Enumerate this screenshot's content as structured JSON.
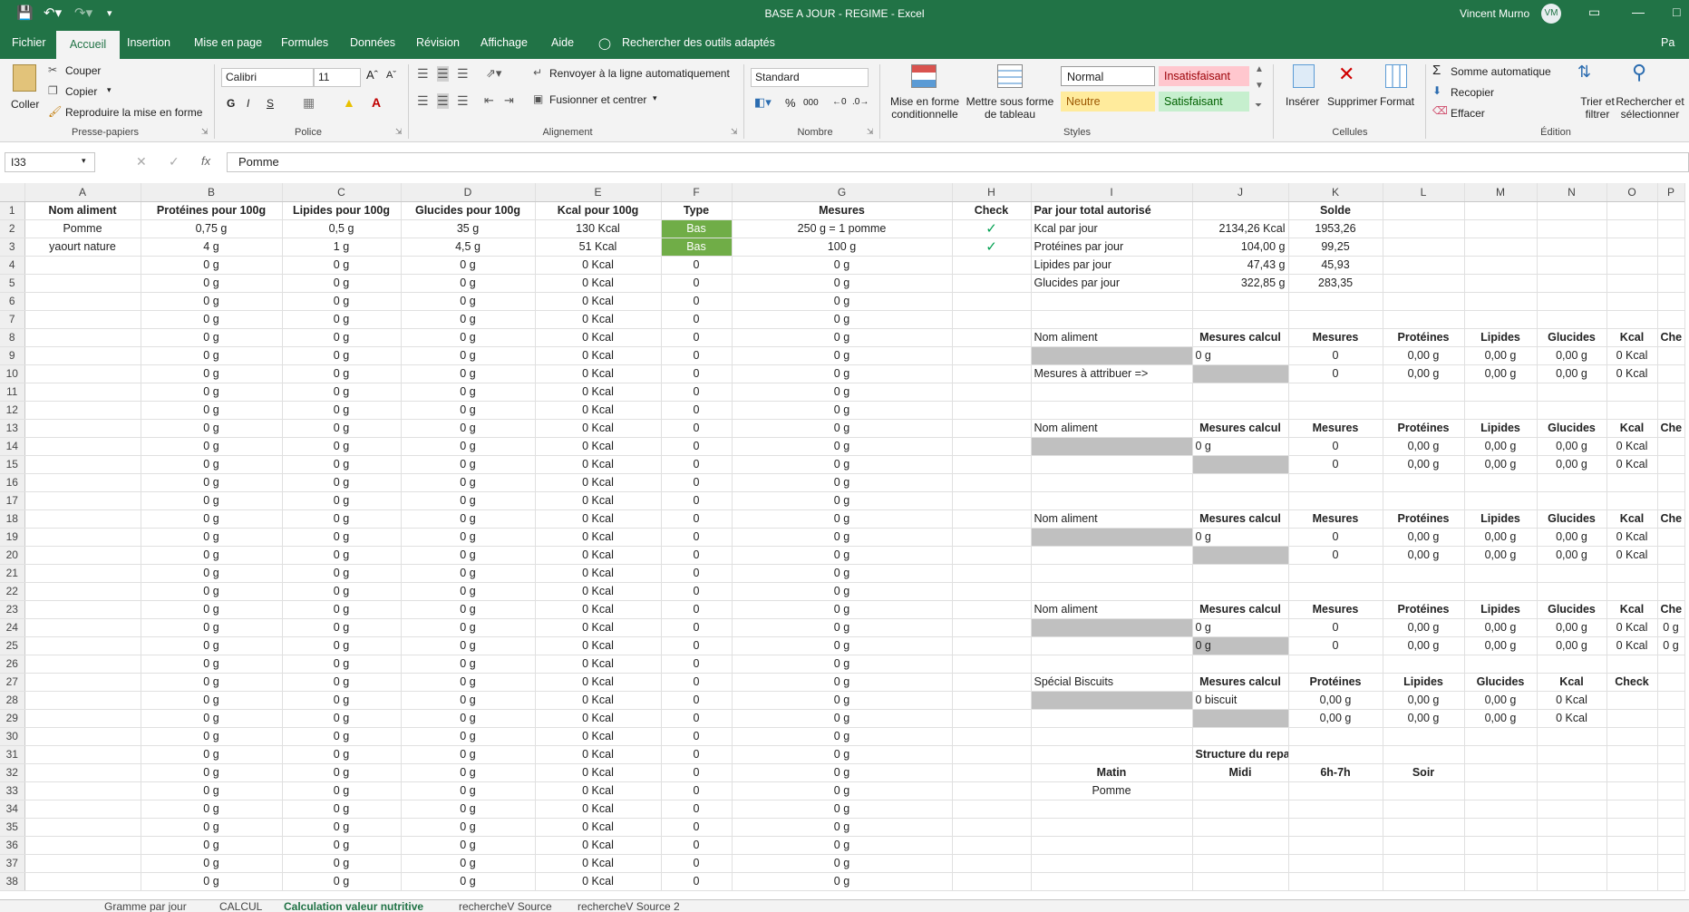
{
  "window": {
    "title": "BASE A JOUR - REGIME  -  Excel",
    "user_name": "Vincent Murno",
    "user_initials": "VM",
    "accent_color": "#217346"
  },
  "ribbon_tabs": [
    "Fichier",
    "Accueil",
    "Insertion",
    "Mise en page",
    "Formules",
    "Données",
    "Révision",
    "Affichage",
    "Aide"
  ],
  "tell_me": "Rechercher des outils adaptés",
  "share_label": "Pa",
  "clipboard": {
    "paste": "Coller",
    "cut": "Couper",
    "copy": "Copier",
    "format_painter": "Reproduire la mise en forme",
    "group": "Presse-papiers"
  },
  "font": {
    "name": "Calibri",
    "size": "11",
    "group": "Police"
  },
  "alignment": {
    "wrap": "Renvoyer à la ligne automatiquement",
    "merge": "Fusionner et centrer",
    "group": "Alignement"
  },
  "number": {
    "format": "Standard",
    "group": "Nombre"
  },
  "styles": {
    "conditional": "Mise en forme conditionnelle",
    "as_table": "Mettre sous forme de tableau",
    "normal": "Normal",
    "bad": "Insatisfaisant",
    "neutral": "Neutre",
    "good": "Satisfaisant",
    "group": "Styles"
  },
  "cells": {
    "insert": "Insérer",
    "delete": "Supprimer",
    "format": "Format",
    "group": "Cellules"
  },
  "editing": {
    "autosum": "Somme automatique",
    "fill": "Recopier",
    "clear": "Effacer",
    "sort": "Trier et filtrer",
    "find": "Rechercher et sélectionner",
    "group": "Édition"
  },
  "formula_bar": {
    "name_box": "I33",
    "value": "Pomme"
  },
  "sheet_tabs": [
    "Gramme par jour",
    "CALCUL",
    "Calculation valeur nutritive",
    "rechercheV Source",
    "rechercheV Source 2"
  ],
  "active_sheet": "Calculation valeur nutritive",
  "columns": [
    "A",
    "B",
    "C",
    "D",
    "E",
    "F",
    "G",
    "H",
    "I",
    "J",
    "K",
    "L",
    "M",
    "N",
    "O",
    "P"
  ],
  "rows": [
    [
      "Nom aliment",
      "Protéines pour 100g",
      "Lipides pour 100g",
      "Glucides pour 100g",
      "Kcal pour 100g",
      "Type",
      "Mesures",
      "Check",
      "Par jour total autorisé",
      "",
      "Solde",
      "",
      "",
      "",
      "",
      ""
    ],
    [
      "Pomme",
      "0,75 g",
      "0,5 g",
      "35 g",
      "130 Kcal",
      "Bas",
      "250 g = 1 pomme",
      "✓",
      "Kcal par jour",
      "2134,26 Kcal",
      "1953,26",
      "",
      "",
      "",
      "",
      ""
    ],
    [
      "yaourt nature",
      "4 g",
      "1 g",
      "4,5 g",
      "51 Kcal",
      "Bas",
      "100 g",
      "✓",
      "Protéines par jour",
      "104,00 g",
      "99,25",
      "",
      "",
      "",
      "",
      ""
    ],
    [
      "",
      "0 g",
      "0 g",
      "0 g",
      "0 Kcal",
      "0",
      "0 g",
      "",
      "Lipides par jour",
      "47,43 g",
      "45,93",
      "",
      "",
      "",
      "",
      ""
    ],
    [
      "",
      "0 g",
      "0 g",
      "0 g",
      "0 Kcal",
      "0",
      "0 g",
      "",
      "Glucides par jour",
      "322,85 g",
      "283,35",
      "",
      "",
      "",
      "",
      ""
    ],
    [
      "",
      "0 g",
      "0 g",
      "0 g",
      "0 Kcal",
      "0",
      "0 g",
      "",
      "",
      "",
      "",
      "",
      "",
      "",
      "",
      ""
    ],
    [
      "",
      "0 g",
      "0 g",
      "0 g",
      "0 Kcal",
      "0",
      "0 g",
      "",
      "",
      "",
      "",
      "",
      "",
      "",
      "",
      ""
    ],
    [
      "",
      "0 g",
      "0 g",
      "0 g",
      "0 Kcal",
      "0",
      "0 g",
      "",
      "Nom aliment",
      "Mesures calcul",
      "Mesures",
      "Protéines",
      "Lipides",
      "Glucides",
      "Kcal",
      "Che"
    ],
    [
      "",
      "0 g",
      "0 g",
      "0 g",
      "0 Kcal",
      "0",
      "0 g",
      "",
      "",
      "0 g",
      "0",
      "0,00 g",
      "0,00 g",
      "0,00 g",
      "0 Kcal",
      ""
    ],
    [
      "",
      "0 g",
      "0 g",
      "0 g",
      "0 Kcal",
      "0",
      "0 g",
      "",
      "Mesures à attribuer =>",
      "",
      "0",
      "0,00 g",
      "0,00 g",
      "0,00 g",
      "0 Kcal",
      ""
    ],
    [
      "",
      "0 g",
      "0 g",
      "0 g",
      "0 Kcal",
      "0",
      "0 g",
      "",
      "",
      "",
      "",
      "",
      "",
      "",
      "",
      ""
    ],
    [
      "",
      "0 g",
      "0 g",
      "0 g",
      "0 Kcal",
      "0",
      "0 g",
      "",
      "",
      "",
      "",
      "",
      "",
      "",
      "",
      ""
    ],
    [
      "",
      "0 g",
      "0 g",
      "0 g",
      "0 Kcal",
      "0",
      "0 g",
      "",
      "Nom aliment",
      "Mesures calcul",
      "Mesures",
      "Protéines",
      "Lipides",
      "Glucides",
      "Kcal",
      "Che"
    ],
    [
      "",
      "0 g",
      "0 g",
      "0 g",
      "0 Kcal",
      "0",
      "0 g",
      "",
      "",
      "0 g",
      "0",
      "0,00 g",
      "0,00 g",
      "0,00 g",
      "0 Kcal",
      ""
    ],
    [
      "",
      "0 g",
      "0 g",
      "0 g",
      "0 Kcal",
      "0",
      "0 g",
      "",
      "",
      "",
      "0",
      "0,00 g",
      "0,00 g",
      "0,00 g",
      "0 Kcal",
      ""
    ],
    [
      "",
      "0 g",
      "0 g",
      "0 g",
      "0 Kcal",
      "0",
      "0 g",
      "",
      "",
      "",
      "",
      "",
      "",
      "",
      "",
      ""
    ],
    [
      "",
      "0 g",
      "0 g",
      "0 g",
      "0 Kcal",
      "0",
      "0 g",
      "",
      "",
      "",
      "",
      "",
      "",
      "",
      "",
      ""
    ],
    [
      "",
      "0 g",
      "0 g",
      "0 g",
      "0 Kcal",
      "0",
      "0 g",
      "",
      "Nom aliment",
      "Mesures calcul",
      "Mesures",
      "Protéines",
      "Lipides",
      "Glucides",
      "Kcal",
      "Che"
    ],
    [
      "",
      "0 g",
      "0 g",
      "0 g",
      "0 Kcal",
      "0",
      "0 g",
      "",
      "",
      "0 g",
      "0",
      "0,00 g",
      "0,00 g",
      "0,00 g",
      "0 Kcal",
      ""
    ],
    [
      "",
      "0 g",
      "0 g",
      "0 g",
      "0 Kcal",
      "0",
      "0 g",
      "",
      "",
      "",
      "0",
      "0,00 g",
      "0,00 g",
      "0,00 g",
      "0 Kcal",
      ""
    ],
    [
      "",
      "0 g",
      "0 g",
      "0 g",
      "0 Kcal",
      "0",
      "0 g",
      "",
      "",
      "",
      "",
      "",
      "",
      "",
      "",
      ""
    ],
    [
      "",
      "0 g",
      "0 g",
      "0 g",
      "0 Kcal",
      "0",
      "0 g",
      "",
      "",
      "",
      "",
      "",
      "",
      "",
      "",
      ""
    ],
    [
      "",
      "0 g",
      "0 g",
      "0 g",
      "0 Kcal",
      "0",
      "0 g",
      "",
      "Nom aliment",
      "Mesures calcul",
      "Mesures",
      "Protéines",
      "Lipides",
      "Glucides",
      "Kcal",
      "Che"
    ],
    [
      "",
      "0 g",
      "0 g",
      "0 g",
      "0 Kcal",
      "0",
      "0 g",
      "",
      "",
      "0 g",
      "0",
      "0,00 g",
      "0,00 g",
      "0,00 g",
      "0 Kcal",
      "0 g"
    ],
    [
      "",
      "0 g",
      "0 g",
      "0 g",
      "0 Kcal",
      "0",
      "0 g",
      "",
      "",
      "0 g",
      "0",
      "0,00 g",
      "0,00 g",
      "0,00 g",
      "0 Kcal",
      "0 g"
    ],
    [
      "",
      "0 g",
      "0 g",
      "0 g",
      "0 Kcal",
      "0",
      "0 g",
      "",
      "",
      "",
      "",
      "",
      "",
      "",
      "",
      ""
    ],
    [
      "",
      "0 g",
      "0 g",
      "0 g",
      "0 Kcal",
      "0",
      "0 g",
      "",
      "Spécial Biscuits",
      "Mesures calcul",
      "Protéines",
      "Lipides",
      "Glucides",
      "Kcal",
      "Check",
      ""
    ],
    [
      "",
      "0 g",
      "0 g",
      "0 g",
      "0 Kcal",
      "0",
      "0 g",
      "",
      "",
      "0 biscuit",
      "0,00 g",
      "0,00 g",
      "0,00 g",
      "0 Kcal",
      "",
      ""
    ],
    [
      "",
      "0 g",
      "0 g",
      "0 g",
      "0 Kcal",
      "0",
      "0 g",
      "",
      "",
      "",
      "0,00 g",
      "0,00 g",
      "0,00 g",
      "0 Kcal",
      "",
      ""
    ],
    [
      "",
      "0 g",
      "0 g",
      "0 g",
      "0 Kcal",
      "0",
      "0 g",
      "",
      "",
      "",
      "",
      "",
      "",
      "",
      "",
      ""
    ],
    [
      "",
      "0 g",
      "0 g",
      "0 g",
      "0 Kcal",
      "0",
      "0 g",
      "",
      "",
      "Structure du repas",
      "",
      "",
      "",
      "",
      "",
      ""
    ],
    [
      "",
      "0 g",
      "0 g",
      "0 g",
      "0 Kcal",
      "0",
      "0 g",
      "",
      "Matin",
      "Midi",
      "6h-7h",
      "Soir",
      "",
      "",
      "",
      ""
    ],
    [
      "",
      "0 g",
      "0 g",
      "0 g",
      "0 Kcal",
      "0",
      "0 g",
      "",
      "Pomme",
      "",
      "",
      "",
      "",
      "",
      "",
      ""
    ],
    [
      "",
      "0 g",
      "0 g",
      "0 g",
      "0 Kcal",
      "0",
      "0 g",
      "",
      "",
      "",
      "",
      "",
      "",
      "",
      "",
      ""
    ],
    [
      "",
      "0 g",
      "0 g",
      "0 g",
      "0 Kcal",
      "0",
      "0 g",
      "",
      "",
      "",
      "",
      "",
      "",
      "",
      "",
      ""
    ],
    [
      "",
      "0 g",
      "0 g",
      "0 g",
      "0 Kcal",
      "0",
      "0 g",
      "",
      "",
      "",
      "",
      "",
      "",
      "",
      "",
      ""
    ],
    [
      "",
      "0 g",
      "0 g",
      "0 g",
      "0 Kcal",
      "0",
      "0 g",
      "",
      "",
      "",
      "",
      "",
      "",
      "",
      "",
      ""
    ],
    [
      "",
      "0 g",
      "0 g",
      "0 g",
      "0 Kcal",
      "0",
      "0 g",
      "",
      "",
      "",
      "",
      "",
      "",
      "",
      "",
      ""
    ]
  ]
}
